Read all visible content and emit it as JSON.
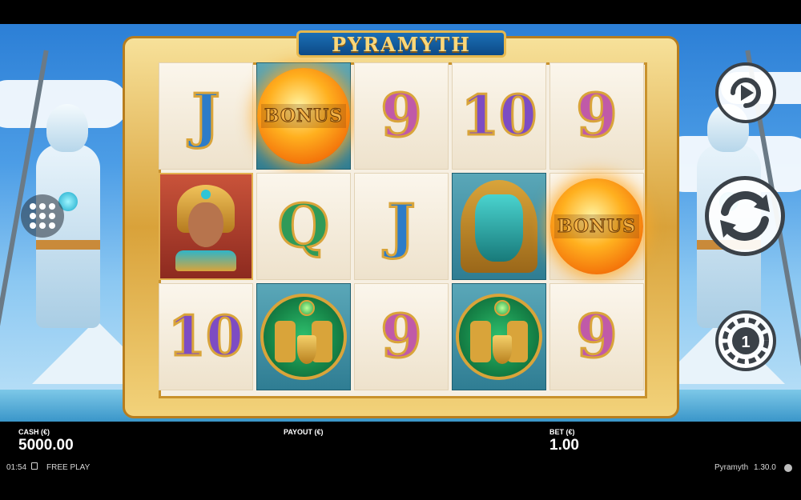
{
  "game": {
    "logo": "PYRAMYTH"
  },
  "reels": [
    [
      {
        "symbol": "J",
        "type": "letter"
      },
      {
        "symbol": "queen",
        "type": "queen"
      },
      {
        "symbol": "10",
        "type": "letter"
      }
    ],
    [
      {
        "symbol": "BONUS",
        "type": "bonus"
      },
      {
        "symbol": "Q",
        "type": "letter"
      },
      {
        "symbol": "horus",
        "type": "horus"
      }
    ],
    [
      {
        "symbol": "9",
        "type": "letter"
      },
      {
        "symbol": "J",
        "type": "letter"
      },
      {
        "symbol": "9",
        "type": "letter"
      }
    ],
    [
      {
        "symbol": "10",
        "type": "letter"
      },
      {
        "symbol": "sobek",
        "type": "sobek"
      },
      {
        "symbol": "horus",
        "type": "horus"
      }
    ],
    [
      {
        "symbol": "9",
        "type": "letter"
      },
      {
        "symbol": "BONUS",
        "type": "bonus"
      },
      {
        "symbol": "9",
        "type": "letter"
      }
    ]
  ],
  "controls": {
    "menu_icon": "menu-dots-icon",
    "autoplay_icon": "autoplay-icon",
    "spin_icon": "spin-icon",
    "bet_icon": "bet-coin-icon",
    "bet_coin_value": "1"
  },
  "footer": {
    "cash_label": "CASH (€)",
    "cash_value": "5000.00",
    "payout_label": "PAYOUT (€)",
    "bet_label": "BET (€)",
    "bet_value": "1.00",
    "clock": "01:54",
    "mode": "FREE PLAY",
    "game_name": "Pyramyth",
    "version": "1.30.0"
  },
  "colors": {
    "frame_gold": "#d9a23a",
    "logo_blue": "#0d4a86",
    "bonus_orange": "#f26b07",
    "sky": "#4c9de6"
  }
}
